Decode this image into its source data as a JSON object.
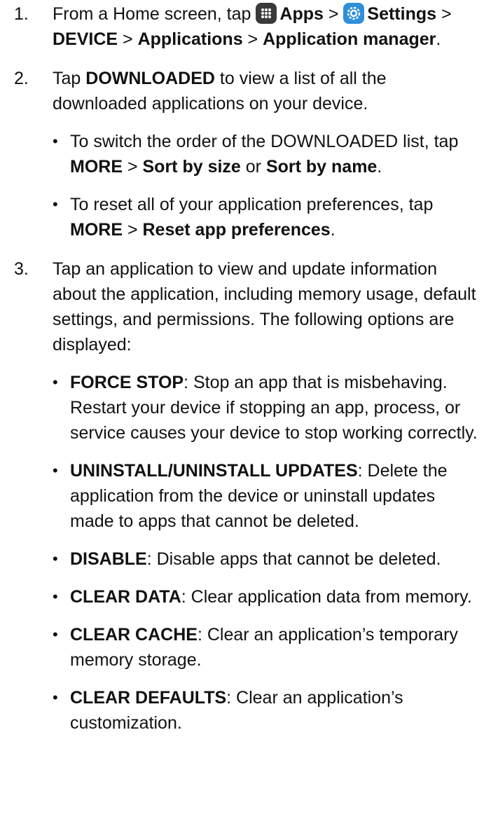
{
  "steps": [
    {
      "num": "1.",
      "parts": {
        "a": "From a Home screen, tap ",
        "b_apps": "Apps",
        "c": " > ",
        "d_settings": "Settings",
        "e": " > ",
        "f_device": "DEVICE",
        "g": " > ",
        "h_applications": "Applications",
        "i": " > ",
        "j_appmanager": "Application manager",
        "k": "."
      },
      "icons": [
        "apps-grid-icon",
        "settings-gear-icon"
      ]
    },
    {
      "num": "2.",
      "parts": {
        "a": "Tap ",
        "b": "DOWNLOADED",
        "c": " to view a list of all the downloaded applications on your device."
      },
      "bullets": [
        {
          "a": "To switch the order of the DOWNLOADED list, tap ",
          "b": "MORE",
          "c": " > ",
          "d": "Sort by size",
          "e": " or ",
          "f": "Sort by name",
          "g": "."
        },
        {
          "a": "To reset all of your application preferences, tap ",
          "b": "MORE",
          "c": " > ",
          "d": "Reset app preferences",
          "e": "."
        }
      ]
    },
    {
      "num": "3.",
      "text": "Tap an application to view and update information about the application, including memory usage, default settings, and permissions. The following options are displayed:",
      "bullets": [
        {
          "term": "FORCE STOP",
          "desc": ": Stop an app that is misbehaving. Restart your device if stopping an app, process, or service causes your device to stop working correctly."
        },
        {
          "term": "UNINSTALL/UNINSTALL UPDATES",
          "desc": ": Delete the application from the device or uninstall updates made to apps that cannot be deleted."
        },
        {
          "term": "DISABLE",
          "desc": ": Disable apps that cannot be deleted."
        },
        {
          "term": "CLEAR DATA",
          "desc": ": Clear application data from memory."
        },
        {
          "term": "CLEAR CACHE",
          "desc": ": Clear an application’s temporary memory storage."
        },
        {
          "term": "CLEAR DEFAULTS",
          "desc": ": Clear an application’s customization."
        }
      ]
    }
  ],
  "bullet_char": "•",
  "colors": {
    "text": "#111111",
    "settings_icon": "#2f8fd8",
    "apps_icon": "#3a3a3a"
  }
}
